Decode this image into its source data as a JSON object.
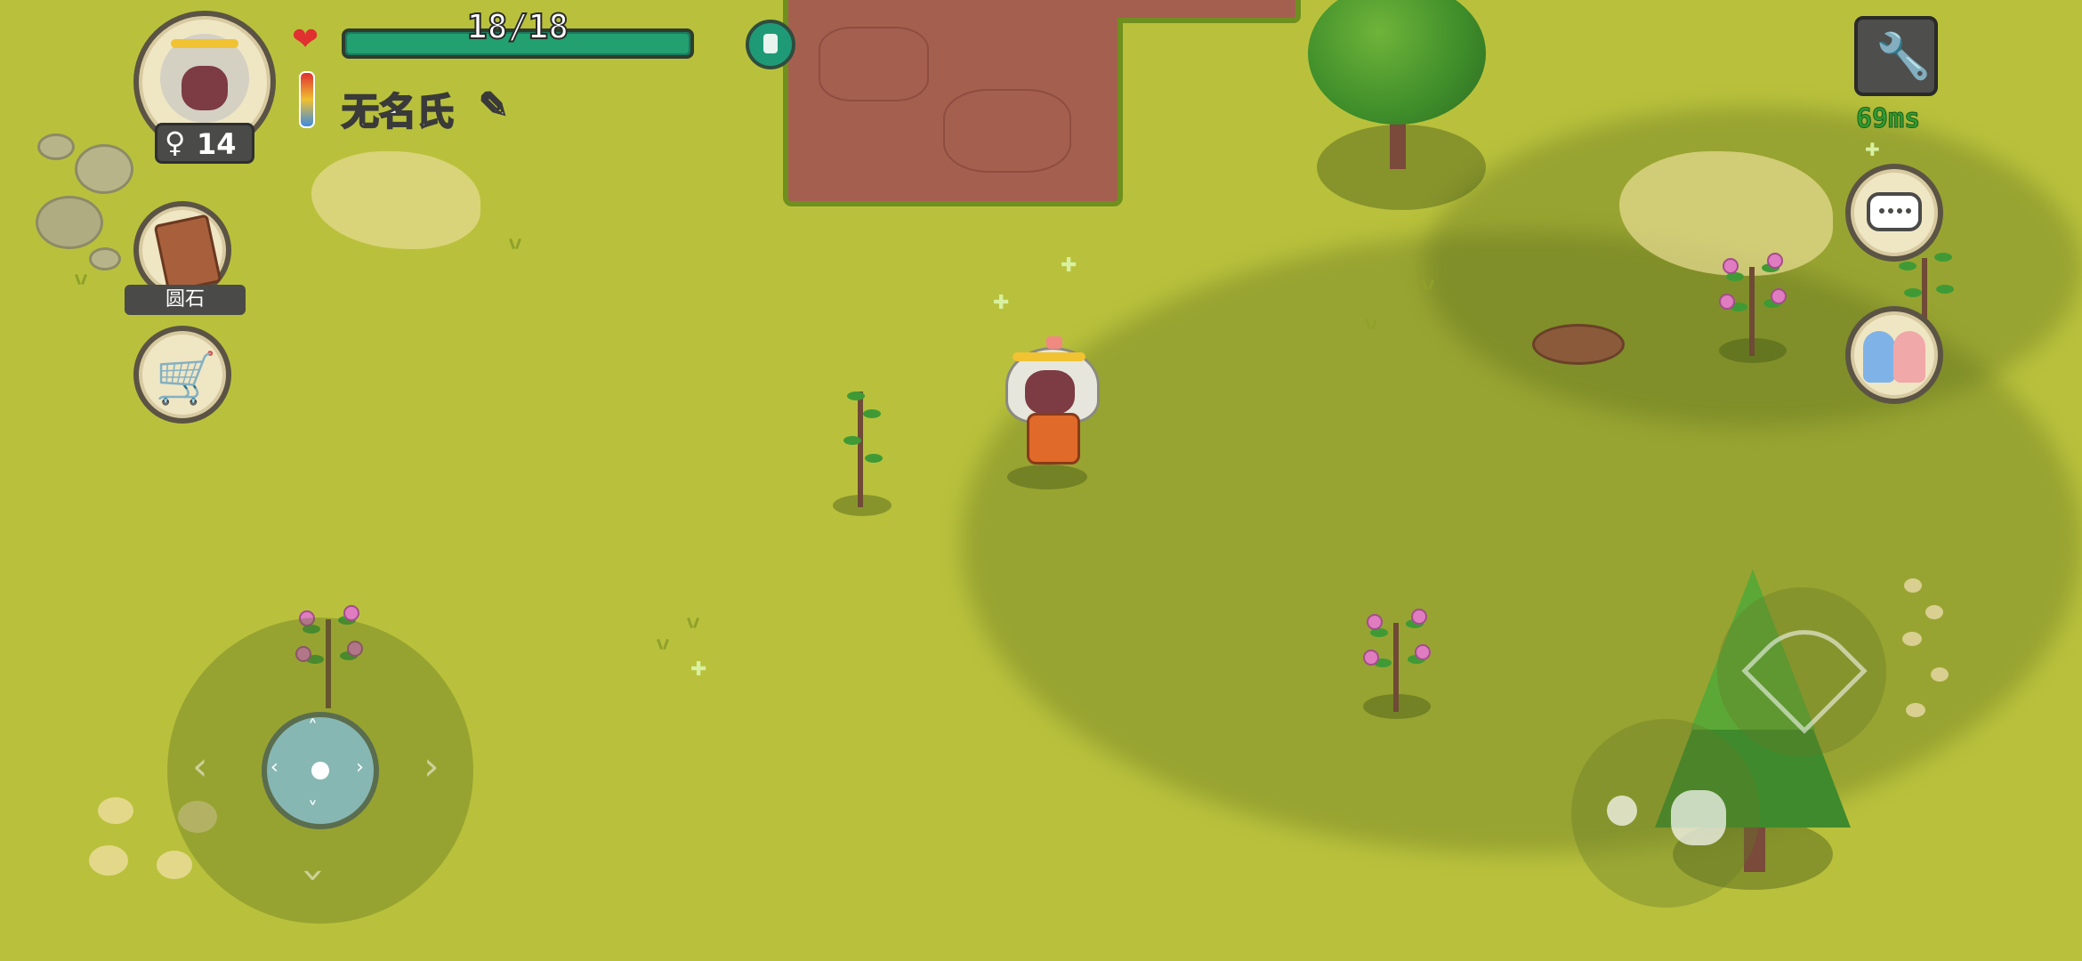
{
  "hud": {
    "health": {
      "current": 18,
      "max": 18,
      "text": "18/18",
      "fraction": 1.0
    },
    "player_name": "无名氏",
    "player_age": "14",
    "player_gender": "female",
    "held_item_label": "圆石",
    "ping_text": "69ms",
    "icons": {
      "health": "heart-icon",
      "temperature": "thermometer-icon",
      "edit": "pencil-icon",
      "backpack": "backpack-icon",
      "settings": "wrench-icon",
      "chat": "speech-bubble-icon",
      "social": "friends-icon",
      "shop": "shopping-cart-icon",
      "attack": "bow-icon",
      "grab": "hand-icon"
    }
  },
  "colors": {
    "grass": "#b9c13c",
    "dirt": "#a55f4f",
    "health_bar": "#22a06f",
    "ping": "#2f9a2f"
  }
}
